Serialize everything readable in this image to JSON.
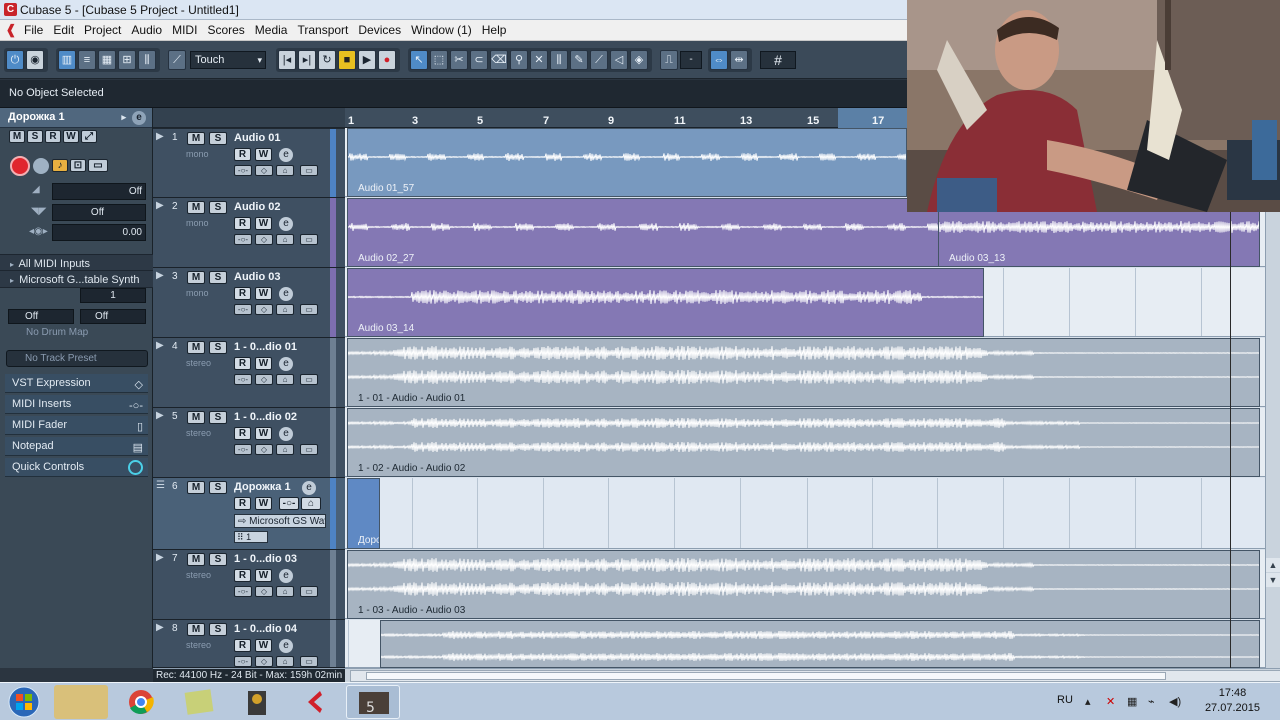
{
  "window": {
    "title": "Cubase 5 - [Cubase 5 Project - Untitled1]"
  },
  "menu": {
    "items": [
      "File",
      "Edit",
      "Project",
      "Audio",
      "MIDI",
      "Scores",
      "Media",
      "Transport",
      "Devices",
      "Window (1)",
      "Help"
    ]
  },
  "toolbar": {
    "automation_mode": "Touch",
    "quantize_value": "-",
    "grid_icon": "#"
  },
  "status": {
    "selection": "No Object Selected"
  },
  "inspector": {
    "track_name": "Дорожка 1",
    "volume_value": "Off",
    "pan_value": "Off",
    "delay_value": "0.00",
    "midi_input": "All MIDI Inputs",
    "midi_output": "Microsoft G...table Synth",
    "channel": "1",
    "bank": "Off",
    "program": "Off",
    "drum_map": "No Drum Map",
    "track_preset": "No Track Preset",
    "sections": [
      "VST Expression",
      "MIDI Inserts",
      "MIDI Fader",
      "Notepad",
      "Quick Controls"
    ]
  },
  "ruler": {
    "bars": [
      "1",
      "3",
      "5",
      "7",
      "9",
      "11",
      "13",
      "15",
      "17"
    ]
  },
  "tracks": [
    {
      "num": "1",
      "name": "Audio 01",
      "sub": "mono",
      "events": [
        "Audio 01_57"
      ]
    },
    {
      "num": "2",
      "name": "Audio 02",
      "sub": "mono",
      "events": [
        "Audio 02_27",
        "Audio 03_13"
      ]
    },
    {
      "num": "3",
      "name": "Audio 03",
      "sub": "mono",
      "events": [
        "Audio 03_14"
      ]
    },
    {
      "num": "4",
      "name": "1 - 0...dio 01",
      "sub": "stereo",
      "events": [
        "1 - 01 - Audio - Audio 01"
      ]
    },
    {
      "num": "5",
      "name": "1 - 0...dio 02",
      "sub": "stereo",
      "events": [
        "1 - 02 - Audio - Audio 02"
      ]
    },
    {
      "num": "6",
      "name": "Дорожка 1",
      "instrument": "Microsoft GS Wav",
      "channel": "1",
      "events": [
        "Доро"
      ]
    },
    {
      "num": "7",
      "name": "1 - 0...dio 03",
      "sub": "stereo",
      "events": [
        "1 - 03 - Audio - Audio 03"
      ]
    },
    {
      "num": "8",
      "name": "1 - 0...dio 04",
      "sub": "stereo",
      "events": []
    }
  ],
  "bottom": {
    "rec_info": "Rec: 44100 Hz - 24 Bit - Max: 159h 02min"
  },
  "taskbar": {
    "lang": "RU",
    "time": "17:48",
    "date": "27.07.2015"
  }
}
